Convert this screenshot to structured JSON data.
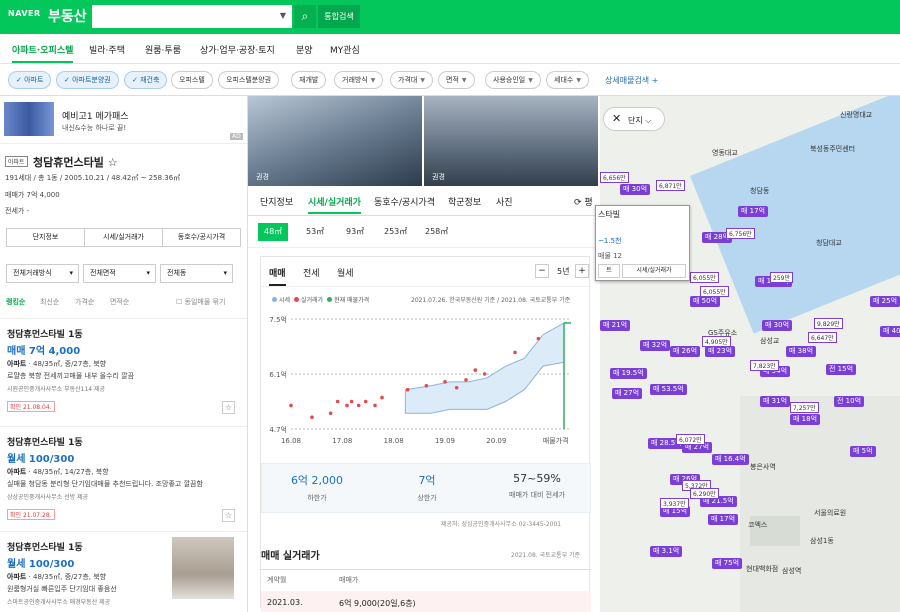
{
  "header": {
    "logo": "NAVER",
    "service": "부동산",
    "search_placeholder": "",
    "search_icon": "search-icon",
    "integrated_search": "통합검색"
  },
  "tabs": [
    "아파트·오피스텔",
    "빌라·주택",
    "원룸·투룸",
    "상가·업무·공장·토지",
    "분양",
    "MY관심"
  ],
  "filters": {
    "active": [
      "아파트",
      "아파트분양권",
      "재건축"
    ],
    "inactive": [
      "오피스텔",
      "오피스텔분양권",
      "재개발"
    ],
    "dropdowns": [
      "거래방식",
      "가격대",
      "면적",
      "사용승인일",
      "세대수"
    ],
    "more": "상세매물검색 +"
  },
  "ad": {
    "title": "예비고1 메가패스",
    "subtitle": "내신&수능 하나로 끝!",
    "tag": "AD"
  },
  "property": {
    "badge": "아파트",
    "name": "청담휴먼스타빌",
    "star": "☆",
    "meta": "191세대 / 총 1동 / 2005.10.21 / 48.42㎡ ~ 258.36㎡",
    "price_line": "매매가 7억 4,000",
    "rent_line": "전세가 -",
    "buttons": [
      "단지정보",
      "시세/실거래가",
      "동호수/공시가격"
    ]
  },
  "list_filters": [
    "전체거래방식",
    "전체면적",
    "전체동"
  ],
  "sort": [
    "랭킹순",
    "최신순",
    "가격순",
    "면적순"
  ],
  "group_option": "동일매물 묶기",
  "listings": [
    {
      "title": "청담휴먼스타빌 1동",
      "price": "매매 7억 4,000",
      "spec": "아파트",
      "spec_detail": " · 48/35㎡, 중/27층, 북향",
      "desc": "로얄층 북향 전세끼고매물 내부 올수리 깔끔",
      "agent": "시원공인중개사사무소   부동산114 제공",
      "status": "확인 21.08.04."
    },
    {
      "title": "청담휴먼스타빌 1동",
      "price": "월세 100/300",
      "spec": "아파트",
      "spec_detail": " · 48/35㎡, 14/27층, 북향",
      "desc": "실매물 청담동 분리형 단기임대매물 추천드립니다. 조망좋고 깔끔함",
      "agent": "상상공인중개사사무소   선방 제공",
      "status": "확인 21.07.28."
    },
    {
      "title": "청담휴먼스타빌 1동",
      "price": "월세 100/300",
      "spec": "아파트",
      "spec_detail": " · 48/35㎡, 중/27층, 북향",
      "desc": "원룸형거실 빠른입주 단기임대 좋음선",
      "agent": "스마트공인중개사사무소   매경부동산 제공",
      "status": ""
    }
  ],
  "photos": [
    "권경",
    "권경"
  ],
  "detail_tabs": [
    "단지정보",
    "시세/실거래가",
    "동호수/공시가격",
    "학군정보",
    "사진"
  ],
  "share_label": "평",
  "sizes": [
    "48㎡",
    "53㎡",
    "93㎡",
    "253㎡",
    "258㎡"
  ],
  "chart_tabs": [
    "매매",
    "전세",
    "월세"
  ],
  "year_range": "5년",
  "legend": [
    "시세",
    "실거래가",
    "현재 매물가격"
  ],
  "legend_colors": {
    "market": "#8ab4dc",
    "real": "#e14b4b",
    "current": "#2fae5b"
  },
  "legend_source": "2021.07.26. 한국부동산원 기준 / 2021.08. 국토교통부 기준",
  "chart_data": {
    "type": "scatter",
    "y_ticks": [
      "7.5억",
      "6.1억",
      "4.7억"
    ],
    "x_ticks": [
      "16.08",
      "17.08",
      "18.08",
      "19.09",
      "20.09",
      "매물가격"
    ],
    "ylim": [
      4.7,
      7.5
    ],
    "real_trades": [
      [
        0.0,
        5.3
      ],
      [
        0.45,
        5.0
      ],
      [
        0.85,
        5.1
      ],
      [
        1.0,
        5.4
      ],
      [
        1.2,
        5.3
      ],
      [
        1.3,
        5.4
      ],
      [
        1.45,
        5.3
      ],
      [
        1.6,
        5.4
      ],
      [
        1.8,
        5.3
      ],
      [
        1.95,
        5.5
      ],
      [
        2.5,
        5.7
      ],
      [
        2.9,
        5.8
      ],
      [
        3.3,
        5.9
      ],
      [
        3.55,
        5.75
      ],
      [
        3.75,
        5.95
      ],
      [
        3.95,
        6.2
      ],
      [
        4.15,
        6.1
      ],
      [
        4.8,
        6.65
      ],
      [
        5.3,
        7.0
      ]
    ],
    "market_low": [
      [
        2.45,
        5.1
      ],
      [
        3.0,
        5.1
      ],
      [
        3.4,
        5.2
      ],
      [
        3.8,
        5.2
      ],
      [
        4.2,
        5.2
      ],
      [
        4.6,
        5.4
      ],
      [
        5.0,
        5.7
      ],
      [
        5.4,
        6.3
      ],
      [
        5.85,
        6.4
      ]
    ],
    "market_high": [
      [
        2.45,
        5.7
      ],
      [
        3.0,
        5.8
      ],
      [
        3.4,
        5.9
      ],
      [
        3.8,
        5.9
      ],
      [
        4.2,
        6.0
      ],
      [
        4.6,
        6.3
      ],
      [
        5.0,
        6.5
      ],
      [
        5.4,
        7.1
      ],
      [
        5.85,
        7.4
      ]
    ],
    "current_price": 7.4
  },
  "price_stats": [
    {
      "value": "6억 2,000",
      "label": "하한가"
    },
    {
      "value": "7억",
      "label": "상한가"
    },
    {
      "value": "57~59%",
      "label": "매매가 대비 전세가"
    }
  ],
  "stats_source": "제공처: 성심공인중개사사무소 02-3445-2001",
  "trade_section": {
    "title": "매매 실거래가",
    "source": "2021.08. 국토교통부 기준",
    "headers": [
      "계약월",
      "매매가"
    ],
    "rows": [
      {
        "month": "2021.03.",
        "price": "6억 9,000(20일,6층)"
      }
    ]
  },
  "map": {
    "control": "단지",
    "popup_title": "스타빌",
    "popup_price": "~1.5천",
    "popup_count": "매물 12",
    "popup_btns": [
      "트",
      "시세/실거래가"
    ],
    "labels": [
      "신랑명대교",
      "북성동주민센터",
      "청담대교",
      "영동대교",
      "GS주유소",
      "삼성교",
      "봉은사역",
      "코엑스",
      "삼성역",
      "현대백화점",
      "서울의료원",
      "삼성1동",
      "청담동"
    ],
    "pins": [
      "매 30억",
      "매 17억",
      "매 28억",
      "매 19.5억",
      "매 50억",
      "매 21억",
      "매 32억",
      "매 26억",
      "매 23억",
      "매 30억",
      "매 38억",
      "매 54억",
      "전 15억",
      "매 19.5억",
      "매 27억",
      "매 53.5억",
      "매 31억",
      "매 18억",
      "전 10억",
      "매 28.5억",
      "매 27억",
      "매 16.4억",
      "매 26억",
      "매 21.5억",
      "매 15억",
      "매 17억",
      "매 3.1억",
      "매 75억",
      "매 5억",
      "매 25억",
      "매 40억"
    ],
    "badges": [
      "6,656만",
      "6,871만",
      "6,055만",
      "6,756만",
      "6,055만",
      "6,647만",
      "4,905만",
      "7,823만",
      "7,257만",
      "6,072만",
      "5,372만",
      "6,290만",
      "3,937만",
      "259만",
      "9,829만"
    ]
  }
}
